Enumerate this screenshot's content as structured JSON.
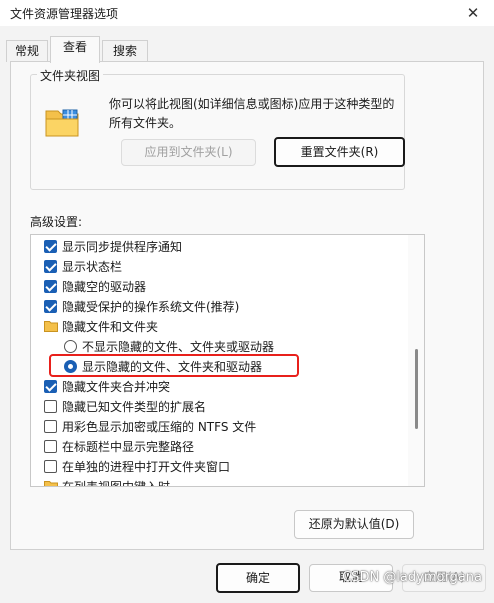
{
  "window": {
    "title": "文件资源管理器选项"
  },
  "tabs": [
    {
      "label": "常规"
    },
    {
      "label": "查看"
    },
    {
      "label": "搜索"
    }
  ],
  "folder_views": {
    "legend": "文件夹视图",
    "description": "你可以将此视图(如详细信息或图标)应用于这种类型的所有文件夹。",
    "apply_button": "应用到文件夹(L)",
    "reset_button": "重置文件夹(R)"
  },
  "advanced": {
    "label": "高级设置:",
    "items": [
      {
        "type": "checkbox",
        "checked": true,
        "label": "显示同步提供程序通知"
      },
      {
        "type": "checkbox",
        "checked": true,
        "label": "显示状态栏"
      },
      {
        "type": "checkbox",
        "checked": true,
        "label": "隐藏空的驱动器"
      },
      {
        "type": "checkbox",
        "checked": true,
        "label": "隐藏受保护的操作系统文件(推荐)"
      },
      {
        "type": "folder",
        "label": "隐藏文件和文件夹"
      },
      {
        "type": "radio",
        "checked": false,
        "label": "不显示隐藏的文件、文件夹或驱动器"
      },
      {
        "type": "radio",
        "checked": true,
        "label": "显示隐藏的文件、文件夹和驱动器"
      },
      {
        "type": "checkbox",
        "checked": true,
        "label": "隐藏文件夹合并冲突"
      },
      {
        "type": "checkbox",
        "checked": false,
        "label": "隐藏已知文件类型的扩展名"
      },
      {
        "type": "checkbox",
        "checked": false,
        "label": "用彩色显示加密或压缩的 NTFS 文件"
      },
      {
        "type": "checkbox",
        "checked": false,
        "label": "在标题栏中显示完整路径"
      },
      {
        "type": "checkbox",
        "checked": false,
        "label": "在单独的进程中打开文件夹窗口"
      },
      {
        "type": "folder",
        "label": "在列表视图中键入时"
      }
    ],
    "restore_button": "还原为默认值(D)"
  },
  "footer": {
    "ok": "确定",
    "cancel": "取消",
    "apply": "应用(A)"
  },
  "watermark": "CSDN @ladymorgana",
  "colors": {
    "accent": "#1a5fb4",
    "highlight": "#e8201b"
  }
}
